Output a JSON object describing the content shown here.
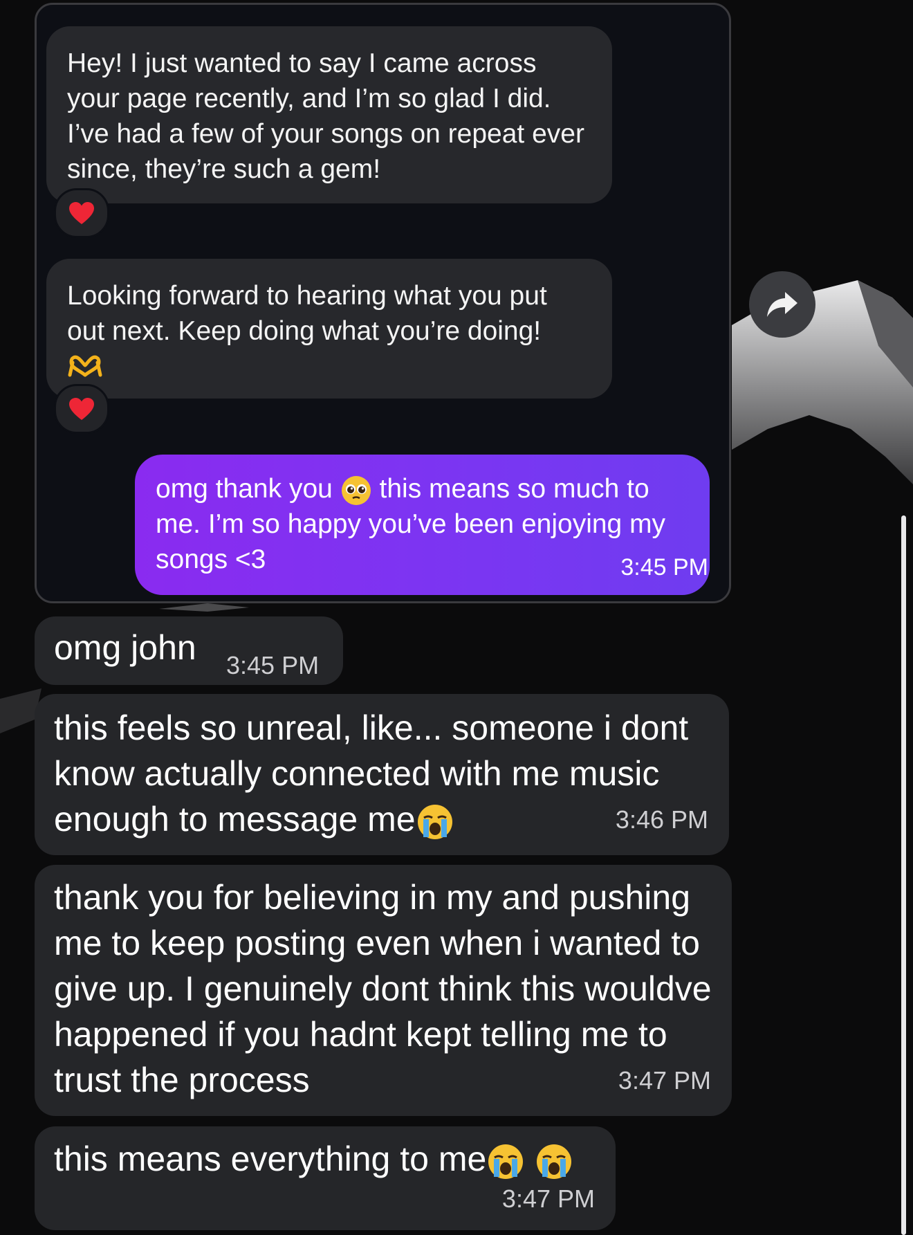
{
  "quoted_messages": [
    {
      "text": "Hey! I just wanted to say I came across your page recently, and I’m so glad I did. I’ve had a few of your songs on repeat ever since, they’re such a gem!",
      "reaction": "heart"
    },
    {
      "text": "Looking forward to hearing what you put out next. Keep doing what you’re doing!",
      "emoji": "heart-hands",
      "reaction": "heart"
    }
  ],
  "sent_message": {
    "text_before_emoji": "omg thank you",
    "emoji": "pleading-face",
    "text_after_emoji": "this means so much to me. I’m so happy you’ve been enjoying my songs <3",
    "time": "3:45 PM",
    "color": "#7a36f2"
  },
  "received_messages": [
    {
      "text": "omg john",
      "time": "3:45 PM"
    },
    {
      "text": "this feels so unreal, like... someone i dont know actually connected with me music enough to message me",
      "emoji": "loudly-crying-face",
      "time": "3:46 PM"
    },
    {
      "text": "thank you for believing in my and pushing me to keep posting even when i wanted to give up. I genuinely dont think this wouldve happened if you hadnt kept telling me to trust the process",
      "time": "3:47 PM"
    },
    {
      "text": "this means everything to me",
      "emoji": "loudly-crying-face",
      "emoji_count": 2,
      "time": "3:47 PM"
    }
  ],
  "share_button": {
    "icon": "share-arrow-icon"
  },
  "colors": {
    "background": "#0b0b0c",
    "bubble": "#252629",
    "accent": "#7a36f2"
  }
}
